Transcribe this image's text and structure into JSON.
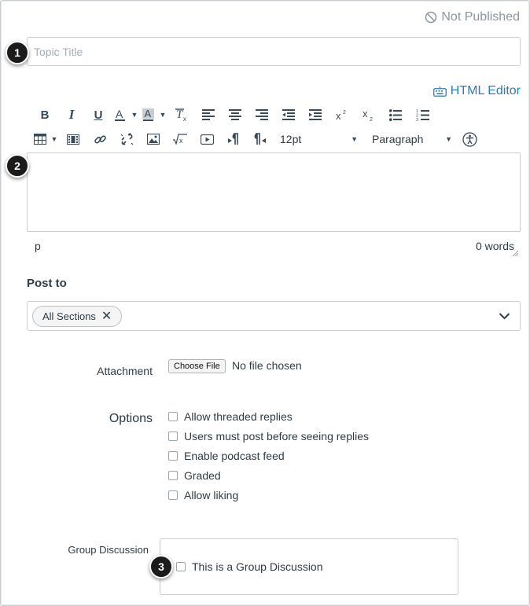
{
  "status": {
    "label": "Not Published",
    "icon": "not-published-icon"
  },
  "topic_title": {
    "placeholder": "Topic Title",
    "value": ""
  },
  "callouts": [
    "1",
    "2",
    "3"
  ],
  "editor": {
    "html_editor_link": "HTML Editor",
    "font_size": "12pt",
    "block_format": "Paragraph",
    "path": "p",
    "word_count": "0 words",
    "toolbar_row1": [
      "bold-icon",
      "italic-icon",
      "underline-icon",
      "text-color-icon",
      "background-color-icon",
      "clear-formatting-icon",
      "align-left-icon",
      "align-center-icon",
      "align-right-icon",
      "outdent-icon",
      "indent-icon",
      "superscript-icon",
      "subscript-icon",
      "bullet-list-icon",
      "numbered-list-icon"
    ],
    "toolbar_row2": [
      "table-icon",
      "media-icon",
      "link-icon",
      "unlink-icon",
      "image-icon",
      "equation-icon",
      "video-icon",
      "ltr-icon",
      "rtl-icon",
      "accessibility-icon"
    ]
  },
  "post_to": {
    "label": "Post to",
    "selected_chip": "All Sections"
  },
  "attachment": {
    "label": "Attachment",
    "button": "Choose File",
    "status": "No file chosen"
  },
  "options": {
    "label": "Options",
    "items": [
      {
        "label": "Allow threaded replies",
        "checked": false
      },
      {
        "label": "Users must post before seeing replies",
        "checked": false
      },
      {
        "label": "Enable podcast feed",
        "checked": false
      },
      {
        "label": "Graded",
        "checked": false
      },
      {
        "label": "Allow liking",
        "checked": false
      }
    ]
  },
  "group_discussion": {
    "label": "Group Discussion",
    "checkbox_label": "This is a Group Discussion",
    "checked": false
  },
  "colors": {
    "link": "#2b7abc",
    "text": "#2d3b45",
    "muted": "#8b969e",
    "border": "#c7cdd1"
  }
}
